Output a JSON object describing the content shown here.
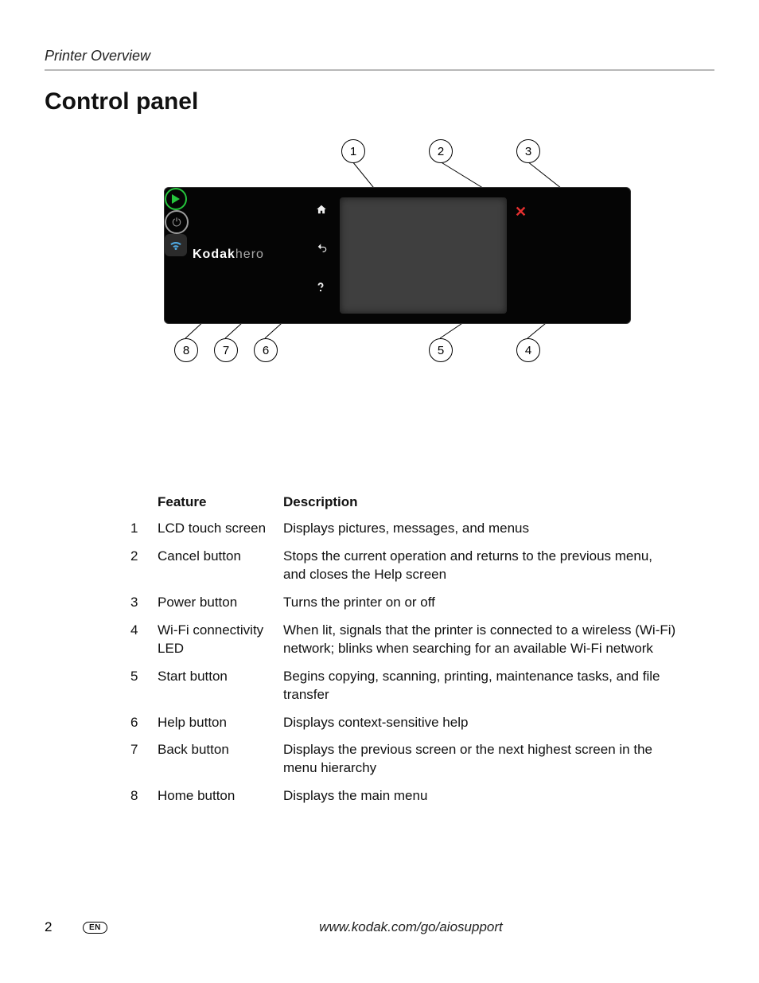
{
  "header": {
    "section": "Printer Overview",
    "title": "Control panel"
  },
  "panel": {
    "brand": "Kodak",
    "product": "hero"
  },
  "callouts": {
    "c1": "1",
    "c2": "2",
    "c3": "3",
    "c4": "4",
    "c5": "5",
    "c6": "6",
    "c7": "7",
    "c8": "8"
  },
  "table": {
    "head_feature": "Feature",
    "head_desc": "Description",
    "rows": [
      {
        "num": "1",
        "feature": "LCD touch screen",
        "desc": "Displays pictures, messages, and menus"
      },
      {
        "num": "2",
        "feature": "Cancel button",
        "desc": "Stops the current operation and returns to the previous menu, and closes the Help screen"
      },
      {
        "num": "3",
        "feature": "Power button",
        "desc": "Turns the printer on or off"
      },
      {
        "num": "4",
        "feature": "Wi-Fi connectivity LED",
        "desc": "When lit, signals that the printer is connected to a wireless (Wi-Fi) network; blinks when searching for an available Wi-Fi network"
      },
      {
        "num": "5",
        "feature": "Start button",
        "desc": "Begins copying, scanning, printing, maintenance tasks, and file transfer"
      },
      {
        "num": "6",
        "feature": "Help button",
        "desc": "Displays context-sensitive help"
      },
      {
        "num": "7",
        "feature": "Back button",
        "desc": "Displays the previous screen or the next highest screen in the menu hierarchy"
      },
      {
        "num": "8",
        "feature": "Home button",
        "desc": "Displays the main menu"
      }
    ]
  },
  "footer": {
    "page": "2",
    "lang": "EN",
    "url": "www.kodak.com/go/aiosupport"
  }
}
